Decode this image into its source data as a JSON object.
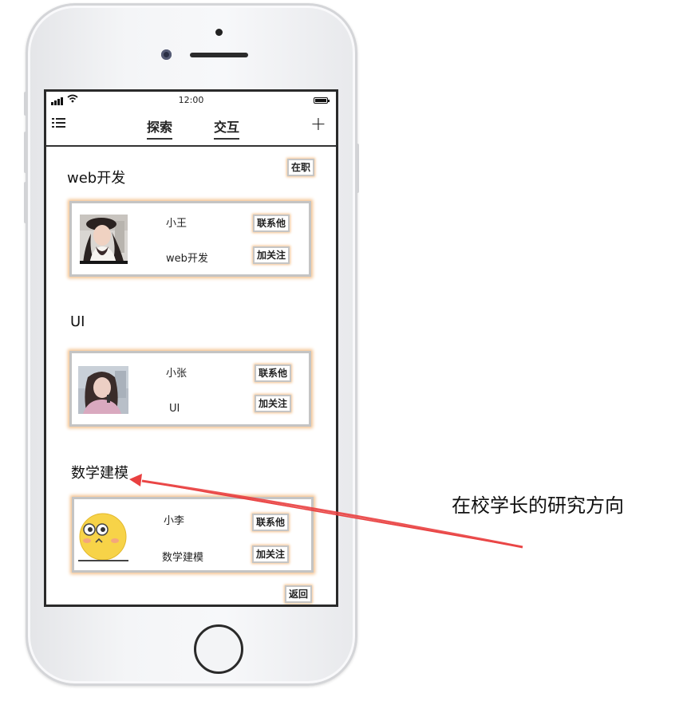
{
  "status_bar": {
    "time": "12:00"
  },
  "nav": {
    "tabs": [
      {
        "label": "探索"
      },
      {
        "label": "交互"
      }
    ],
    "add_symbol": "+"
  },
  "employed_button": "在职",
  "sections": [
    {
      "title": "web开发",
      "person": {
        "name": "小王",
        "direction": "web开发",
        "avatar": "photo-avatar"
      },
      "contact_button": "联系他",
      "follow_button": "加关注"
    },
    {
      "title": "UI",
      "person": {
        "name": "小张",
        "direction": "UI",
        "avatar": "photo-avatar"
      },
      "contact_button": "联系他",
      "follow_button": "加关注"
    },
    {
      "title": "数学建模",
      "person": {
        "name": "小李",
        "direction": "数学建模",
        "avatar": "emoji-face-avatar"
      },
      "contact_button": "联系他",
      "follow_button": "加关注"
    }
  ],
  "back_button": "返回",
  "annotation": "在校学长的研究方向",
  "colors": {
    "card_glow": "#f4c28e",
    "arrow": "#e94040",
    "card_border": "#c4c4c4"
  }
}
